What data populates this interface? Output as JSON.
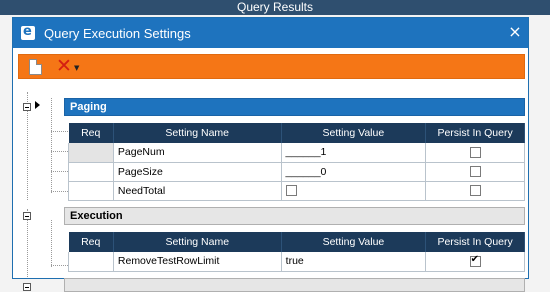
{
  "window": {
    "title": "Query Results"
  },
  "dialog": {
    "title": "Query Execution Settings",
    "close_glyph": "×"
  },
  "toolbar": {
    "new_icon": "new-document-icon",
    "delete_glyph": "✕",
    "dropdown_glyph": "▼"
  },
  "columns": {
    "req": "Req",
    "name": "Setting Name",
    "value": "Setting Value",
    "persist": "Persist In Query"
  },
  "groups": [
    {
      "name": "Paging",
      "rows": [
        {
          "name": "PageNum",
          "value": "______1",
          "persist": false
        },
        {
          "name": "PageSize",
          "value": "______0",
          "persist": false
        },
        {
          "name": "NeedTotal",
          "value_checkbox": false,
          "persist": false
        }
      ]
    },
    {
      "name": "Execution",
      "rows": [
        {
          "name": "RemoveTestRowLimit",
          "value": "true",
          "persist": true
        }
      ]
    }
  ],
  "colors": {
    "accent": "#1e73be",
    "toolbar": "#f57616",
    "header": "#1c3a5a",
    "delete": "#d41e12"
  }
}
